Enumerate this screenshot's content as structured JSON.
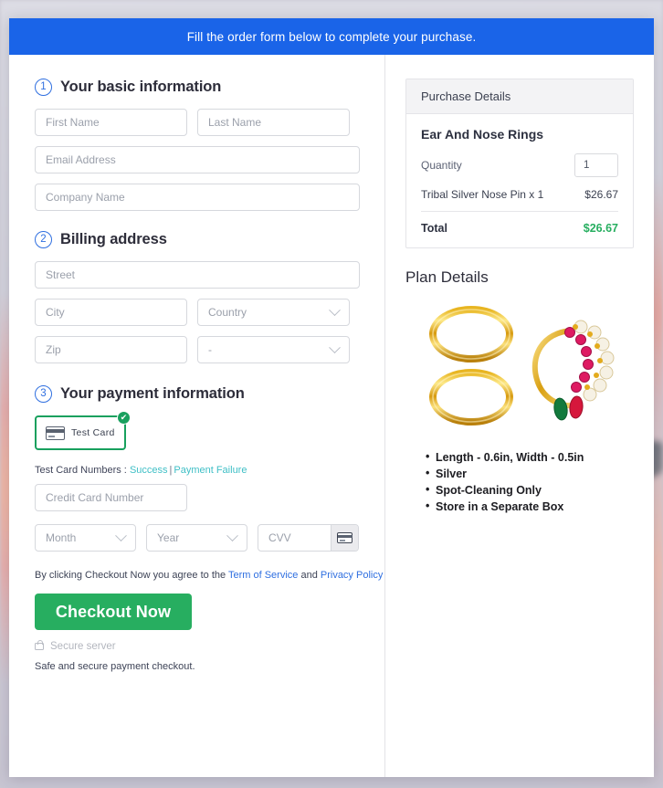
{
  "banner": {
    "text": "Fill the order form below to complete your purchase."
  },
  "steps": [
    {
      "number": "1",
      "title": "Your basic information"
    },
    {
      "number": "2",
      "title": "Billing address"
    },
    {
      "number": "3",
      "title": "Your payment information"
    }
  ],
  "basic_info": {
    "first_name_placeholder": "First Name",
    "last_name_placeholder": "Last Name",
    "email_placeholder": "Email Address",
    "company_placeholder": "Company Name"
  },
  "billing": {
    "street_placeholder": "Street",
    "city_placeholder": "City",
    "country_placeholder": "Country",
    "zip_placeholder": "Zip",
    "state_placeholder": "-"
  },
  "payment": {
    "test_card_label": "Test  Card",
    "card_icon": "credit-card-icon",
    "selected_check": "✔",
    "test_numbers_label": "Test Card Numbers :",
    "success_link": "Success",
    "separator": "|",
    "failure_link": "Payment Failure",
    "card_number_placeholder": "Credit Card Number",
    "month_placeholder": "Month",
    "year_placeholder": "Year",
    "cvv_placeholder": "CVV",
    "cvv_icon": "credit-card-icon"
  },
  "footer": {
    "terms_prefix": "By clicking Checkout Now you agree to the",
    "terms_link": "Term of Service",
    "terms_middle": "and",
    "privacy_link": "Privacy Policy",
    "checkout_label": "Checkout Now",
    "secure_icon": "lock-icon",
    "secure_label": "Secure server",
    "safe_note": "Safe and secure payment checkout."
  },
  "purchase": {
    "panel_title": "Purchase Details",
    "product_title": "Ear And Nose Rings",
    "quantity_label": "Quantity",
    "quantity_value": "1",
    "line_item_label": "Tribal Silver Nose Pin x 1",
    "line_item_price": "$26.67",
    "total_label": "Total",
    "total_amount": "$26.67"
  },
  "plan": {
    "title": "Plan Details",
    "image_alt": "gold-hoop-earrings-and-nose-ring-photo",
    "bullets": [
      "Length - 0.6in, Width - 0.5in",
      "Silver",
      "Spot-Cleaning Only",
      "Store in a Separate Box"
    ]
  },
  "colors": {
    "banner_blue": "#1a64e8",
    "step_blue": "#2f6fe0",
    "success_green": "#27ae60",
    "tile_green": "#18a05e",
    "link_teal": "#3fbfc6"
  }
}
